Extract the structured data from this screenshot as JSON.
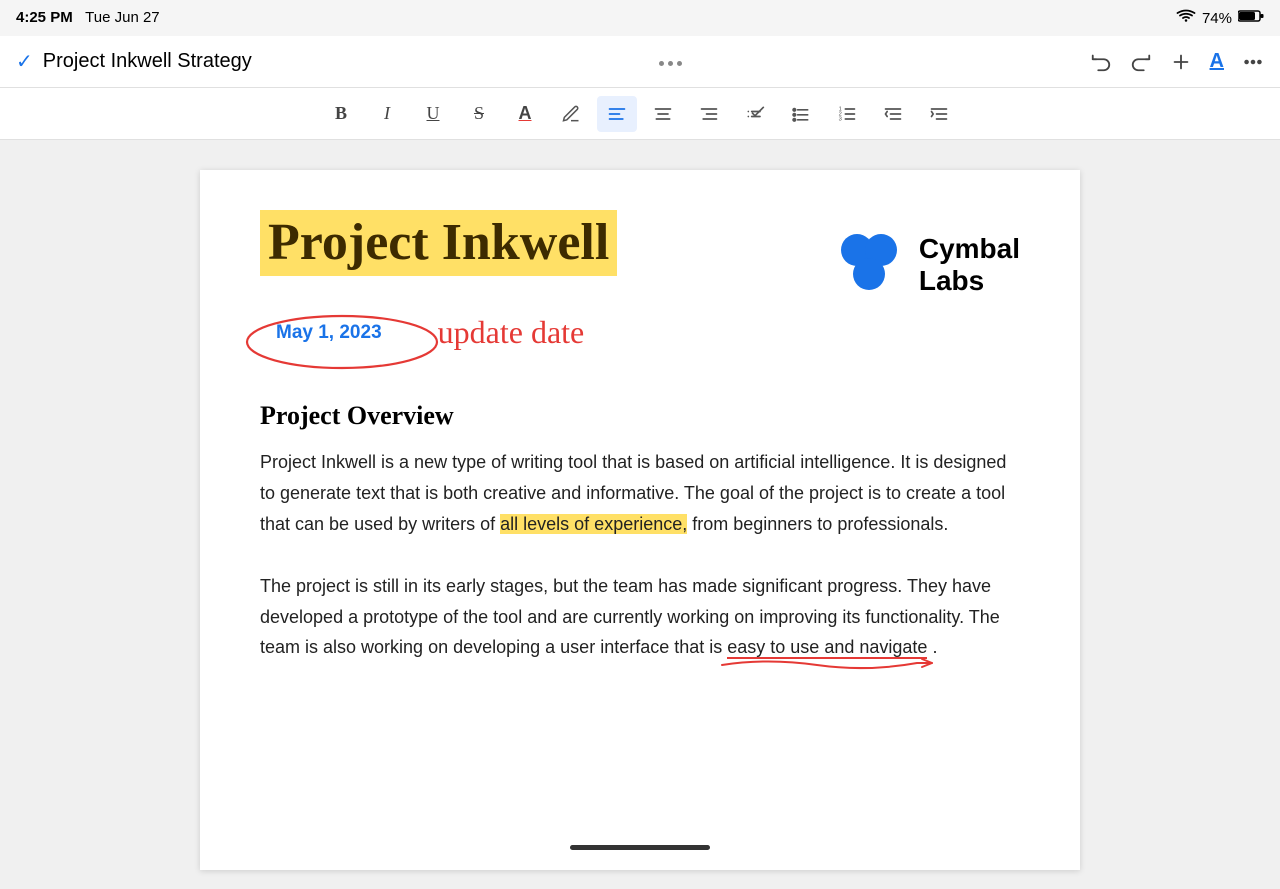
{
  "status": {
    "time": "4:25 PM",
    "date": "Tue Jun 27",
    "battery": "74%"
  },
  "titlebar": {
    "doc_title": "Project Inkwell Strategy",
    "undo_label": "undo",
    "redo_label": "redo",
    "add_label": "add",
    "font_label": "A",
    "more_label": "more"
  },
  "toolbar": {
    "bold": "B",
    "italic": "I",
    "underline": "U",
    "strikethrough": "S",
    "font_color": "A",
    "highlight": "✏",
    "align_left": "≡",
    "align_center": "≡",
    "align_right": "≡",
    "checklist": "☑",
    "bullet": "☰",
    "numbered": "☰",
    "outdent": "⇤",
    "indent": "⇥"
  },
  "document": {
    "main_title": "Project Inkwell",
    "date_label": "May 1, 2023",
    "handwriting": "update date",
    "logo_name": "Cymbal",
    "logo_sub": "Labs",
    "section1_heading": "Project Overview",
    "section1_body1": "Project Inkwell is a new type of writing tool that is based on artificial intelligence. It is designed to generate text that is both creative and informative. The goal of the project is to create a tool that can be used by writers of ",
    "section1_highlighted": "all levels of experience,",
    "section1_body1_end": " from beginners to professionals.",
    "section1_body2_start": "The project is still in its early stages, but the team has made significant progress. They have developed a prototype of the tool and are currently working on improving its functionality. The team is also working on developing a user interface that is ",
    "section1_body2_underlined": "easy to use and navigate",
    "section1_body2_end": "."
  }
}
